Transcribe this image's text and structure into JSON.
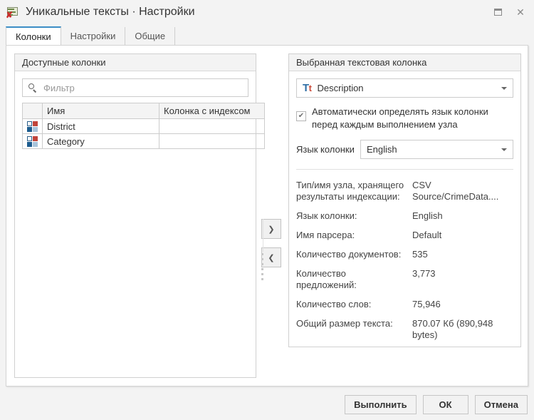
{
  "window": {
    "title": "Уникальные тексты · Настройки",
    "icon": "node-settings-icon",
    "maximize_label": "□",
    "close_label": "✕"
  },
  "tabs": [
    {
      "label": "Колонки",
      "active": true
    },
    {
      "label": "Настройки",
      "active": false
    },
    {
      "label": "Общие",
      "active": false
    }
  ],
  "left_panel": {
    "header": "Доступные колонки",
    "filter": {
      "placeholder": "Фильтр",
      "value": ""
    },
    "table": {
      "headers": [
        "",
        "Имя",
        "Колонка с индексом"
      ],
      "rows": [
        {
          "name": "District",
          "indexed": ""
        },
        {
          "name": "Category",
          "indexed": ""
        }
      ]
    }
  },
  "transfer": {
    "add_label": "❯",
    "remove_label": "❮"
  },
  "right_panel": {
    "header": "Выбранная текстовая колонка",
    "column_combo": {
      "icon_text": "Tt",
      "value": "Description"
    },
    "auto_detect_checkbox": {
      "checked": true,
      "check_glyph": "✔",
      "label": "Автоматически определять язык колонки перед каждым выполнением узла"
    },
    "language_row": {
      "label": "Язык колонки",
      "value": "English"
    },
    "info": [
      {
        "label": "Тип/имя узла, хранящего результаты индексации:",
        "value": "CSV Source/CrimeData...."
      },
      {
        "label": "Язык колонки:",
        "value": "English"
      },
      {
        "label": "Имя парсера:",
        "value": "Default"
      },
      {
        "label": "Количество документов:",
        "value": "535"
      },
      {
        "label": "Количество предложений:",
        "value": "3,773"
      },
      {
        "label": "Количество слов:",
        "value": "75,946"
      },
      {
        "label": "Общий размер текста:",
        "value": "870.07 Кб (890,948 bytes)"
      }
    ]
  },
  "footer": {
    "execute": "Выполнить",
    "ok": "ОК",
    "cancel": "Отмена"
  },
  "colors": {
    "accent": "#3c8dc5",
    "tt_blue": "#2f6ea5",
    "tt_red": "#cc4b3a"
  }
}
